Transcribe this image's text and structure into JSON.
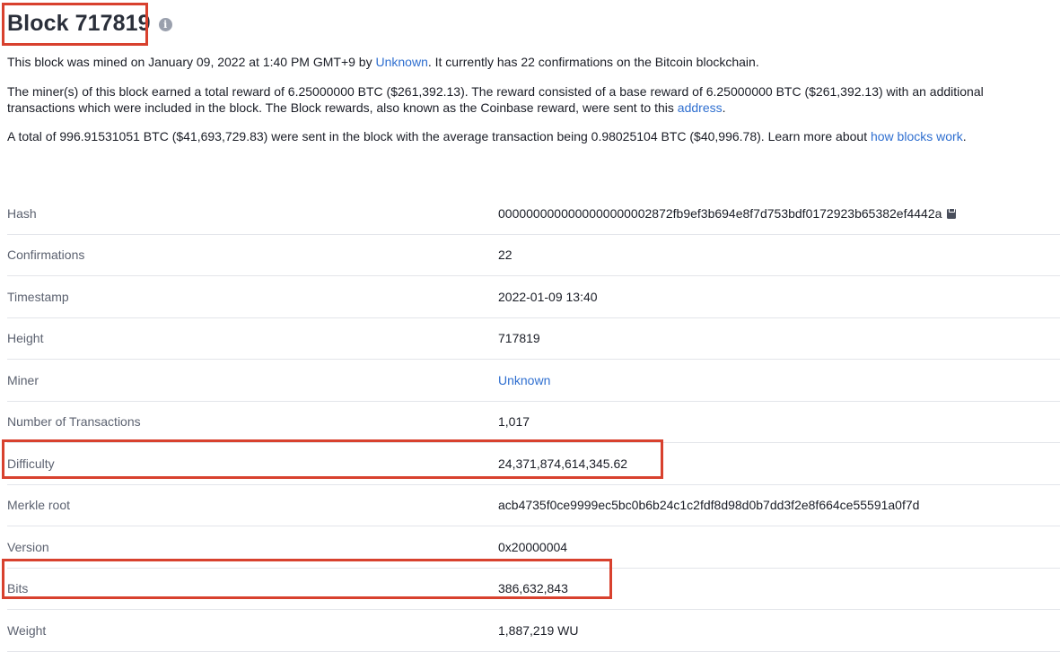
{
  "header": {
    "title": "Block 717819",
    "info_icon": "info-icon"
  },
  "summary": {
    "p1": {
      "before": "This block was mined on January 09, 2022 at 1:40 PM GMT+9 by ",
      "link": "Unknown",
      "after": ". It currently has 22 confirmations on the Bitcoin blockchain."
    },
    "p2": {
      "line1": "The miner(s) of this block earned a total reward of 6.25000000 BTC ($261,392.13). The reward consisted of a base reward of 6.25000000 BTC ($261,392.13) with an additional",
      "line2_before": "transactions which were included in the block. The Block rewards, also known as the Coinbase reward, were sent to this ",
      "line2_link": "address",
      "line2_after": "."
    },
    "p3": {
      "before": "A total of 996.91531051 BTC ($41,693,729.83) were sent in the block with the average transaction being 0.98025104 BTC ($40,996.78).  Learn more about ",
      "link": "how blocks work",
      "after": "."
    }
  },
  "details": [
    {
      "label": "Hash",
      "value": "0000000000000000000002872fb9ef3b694e8f7d753bdf0172923b65382ef4442a",
      "icon": "clipboard-icon"
    },
    {
      "label": "Confirmations",
      "value": "22"
    },
    {
      "label": "Timestamp",
      "value": "2022-01-09 13:40"
    },
    {
      "label": "Height",
      "value": "717819"
    },
    {
      "label": "Miner",
      "value": "Unknown",
      "is_link": true
    },
    {
      "label": "Number of Transactions",
      "value": "1,017"
    },
    {
      "label": "Difficulty",
      "value": "24,371,874,614,345.62"
    },
    {
      "label": "Merkle root",
      "value": "acb4735f0ce9999ec5bc0b6b24c1c2fdf8d98d0b7dd3f2e8f664ce55591a0f7d"
    },
    {
      "label": "Version",
      "value": "0x20000004"
    },
    {
      "label": "Bits",
      "value": "386,632,843"
    },
    {
      "label": "Weight",
      "value": "1,887,219 WU"
    }
  ],
  "colors": {
    "link": "#2f6fd0",
    "highlight": "#d8412e"
  }
}
